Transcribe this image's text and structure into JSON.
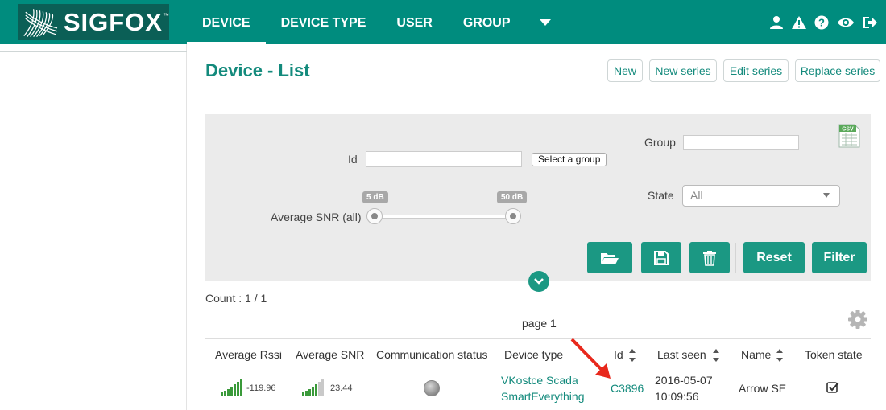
{
  "app": {
    "brand": "SIGFOX",
    "brand_tm": "™",
    "accent_color": "#008c7e",
    "link_color": "#138a7c",
    "button_color": "#1b9883"
  },
  "nav": {
    "items": [
      {
        "label": "DEVICE",
        "active": true
      },
      {
        "label": "DEVICE TYPE",
        "active": false
      },
      {
        "label": "USER",
        "active": false
      },
      {
        "label": "GROUP",
        "active": false
      }
    ],
    "more_icon": "caret-down-icon",
    "right_icons": [
      "user-icon",
      "alert-icon",
      "help-icon",
      "eye-icon",
      "logout-icon"
    ]
  },
  "page": {
    "title": "Device - List",
    "actions": [
      "New",
      "New series",
      "Edit series",
      "Replace series"
    ]
  },
  "filters": {
    "id_label": "Id",
    "id_value": "",
    "select_group_button": "Select a group",
    "group_label": "Group",
    "group_value": "",
    "snr_label": "Average SNR (all)",
    "snr_min": "5 dB",
    "snr_max": "50 dB",
    "state_label": "State",
    "state_value": "All",
    "csv_icon": "csv-export-icon",
    "csv_text": "CSV",
    "buttons": {
      "open_icon": "folder-open-icon",
      "save_icon": "save-icon",
      "delete_icon": "trash-icon",
      "reset": "Reset",
      "filter": "Filter"
    }
  },
  "results": {
    "count": "Count : 1 / 1",
    "page": "page 1",
    "columns": [
      "Average Rssi",
      "Average SNR",
      "Communication status",
      "Device type",
      "Id",
      "Last seen",
      "Name",
      "Token state"
    ],
    "rows": [
      {
        "avg_rssi": "-119.96",
        "avg_snr": "23.44",
        "communication_status": "grey",
        "device_type_line1": "VKostce Scada",
        "device_type_line2": "SmartEverything",
        "id": "C3896",
        "last_seen_date": "2016-05-07",
        "last_seen_time": "10:09:56",
        "name": "Arrow SE",
        "token_state": "checked"
      }
    ]
  }
}
